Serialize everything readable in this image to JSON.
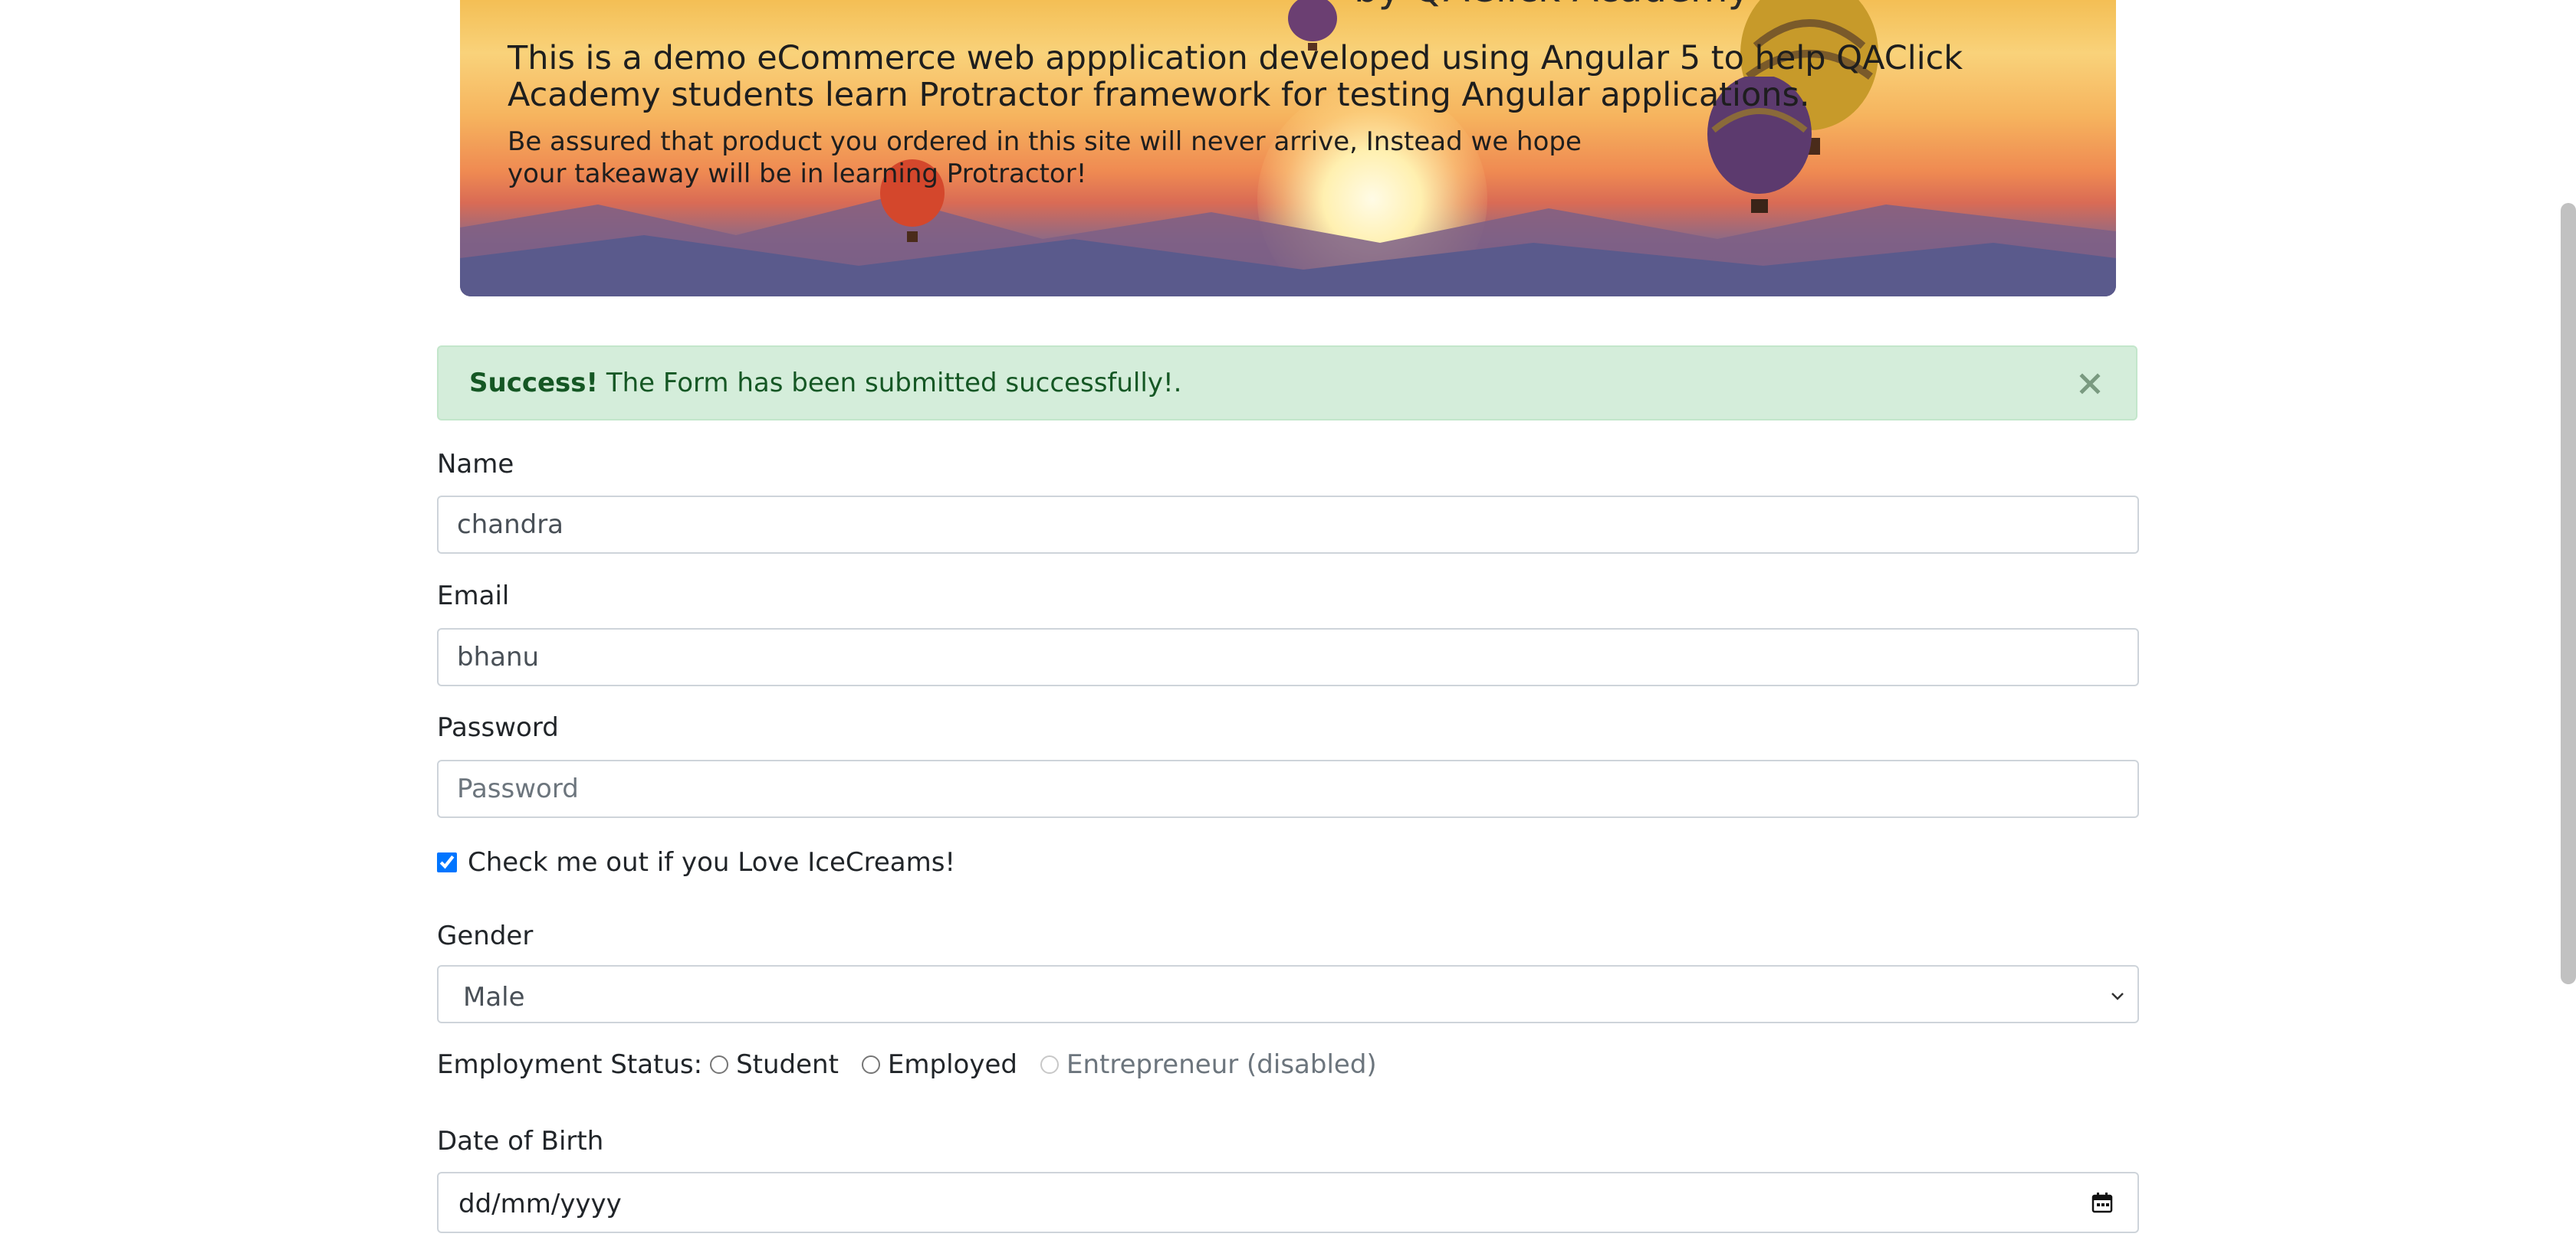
{
  "hero": {
    "title": "by QAClick Academy",
    "lead": "This is a demo eCommerce web appplication developed using Angular 5 to help QAClick Academy students learn Protractor framework for testing Angular applications.",
    "sub": "Be assured that product you ordered in this site will never arrive, Instead we hope your takeaway will be in learning Protractor!"
  },
  "alert": {
    "strong": "Success!",
    "message": " The Form has been submitted successfully!.",
    "close_icon": "close-icon",
    "color": "#155724"
  },
  "form": {
    "name_label": "Name",
    "name_value": "chandra",
    "email_label": "Email",
    "email_value": "bhanu",
    "password_label": "Password",
    "password_placeholder": "Password",
    "password_value": "",
    "checkbox_label": "Check me out if you Love IceCreams!",
    "checkbox_checked": true,
    "gender_label": "Gender",
    "gender_selected": "Male",
    "employment_label": "Employment Status:",
    "employment_options": [
      "Student",
      "Employed",
      "Entrepreneur (disabled)"
    ],
    "dob_label": "Date of Birth",
    "dob_placeholder": "dd/mm/yyyy"
  }
}
